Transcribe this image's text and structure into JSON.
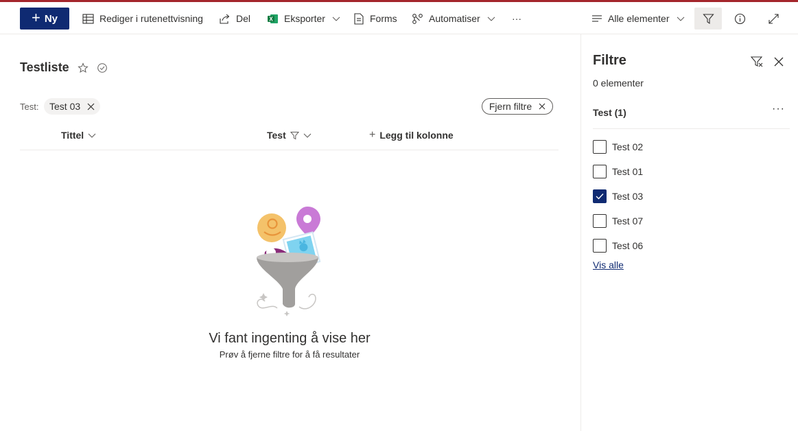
{
  "commandbar": {
    "new_label": "Ny",
    "edit_grid_label": "Rediger i rutenettvisning",
    "share_label": "Del",
    "export_label": "Eksporter",
    "forms_label": "Forms",
    "automate_label": "Automatiser",
    "more_label": "···",
    "view_label": "Alle elementer"
  },
  "list": {
    "title": "Testliste",
    "filter_label": "Test:",
    "filter_chip": "Test 03",
    "clear_filters": "Fjern filtre",
    "columns": {
      "title": "Tittel",
      "test": "Test",
      "add_column": "Legg til kolonne"
    },
    "empty_title": "Vi fant ingenting å vise her",
    "empty_subtitle": "Prøv å fjerne filtre for å få resultater"
  },
  "filter_pane": {
    "title": "Filtre",
    "count": "0 elementer",
    "section_title": "Test (1)",
    "section_more": "···",
    "options": [
      {
        "label": "Test 02",
        "checked": false
      },
      {
        "label": "Test 01",
        "checked": false
      },
      {
        "label": "Test 03",
        "checked": true
      },
      {
        "label": "Test 07",
        "checked": false
      },
      {
        "label": "Test 06",
        "checked": false
      }
    ],
    "see_all": "Vis alle"
  },
  "colors": {
    "accent": "#0f2a72",
    "top_line": "#a4262c",
    "excel_green": "#107c41"
  },
  "icons": [
    "plus-icon",
    "grid-icon",
    "share-icon",
    "excel-icon",
    "chevron-down-icon",
    "forms-icon",
    "flow-icon",
    "list-view-icon",
    "filter-icon",
    "info-icon",
    "expand-icon",
    "star-icon",
    "check-circle-icon",
    "close-icon",
    "filter-clear-icon",
    "checkmark-icon"
  ]
}
